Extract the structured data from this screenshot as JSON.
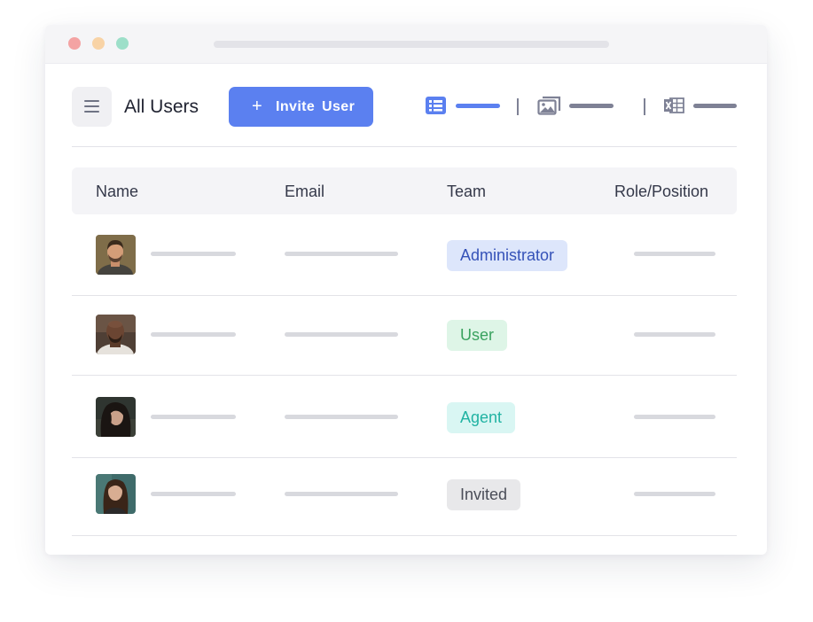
{
  "window": {
    "controls": [
      "close",
      "minimize",
      "maximize"
    ]
  },
  "toolbar": {
    "menu_icon": "hamburger-menu-icon",
    "title": "All Users",
    "invite_button": {
      "icon": "plus-icon",
      "label": "Invite  User"
    },
    "view_options": [
      {
        "icon": "list-view-icon",
        "active": true
      },
      {
        "icon": "gallery-view-icon",
        "active": false
      },
      {
        "icon": "excel-export-icon",
        "active": false
      }
    ]
  },
  "table": {
    "columns": [
      "Name",
      "Email",
      "Team",
      "Role/Position"
    ],
    "rows": [
      {
        "avatar": "avatar-man-beard",
        "team": "Administrator",
        "team_style": "admin"
      },
      {
        "avatar": "avatar-man-bald",
        "team": "User",
        "team_style": "user"
      },
      {
        "avatar": "avatar-woman-dark-hair",
        "team": "Agent",
        "team_style": "agent"
      },
      {
        "avatar": "avatar-woman-long-hair",
        "team": "Invited",
        "team_style": "invited"
      }
    ]
  },
  "colors": {
    "accent": "#5b80f0",
    "admin_badge_bg": "#dde6fb",
    "admin_badge_text": "#3552b8",
    "user_badge_bg": "#def5e7",
    "user_badge_text": "#3aa25f",
    "agent_badge_bg": "#d9f6f3",
    "agent_badge_text": "#21b3a3",
    "invited_badge_bg": "#e8e8ea",
    "invited_badge_text": "#4a4d58"
  }
}
